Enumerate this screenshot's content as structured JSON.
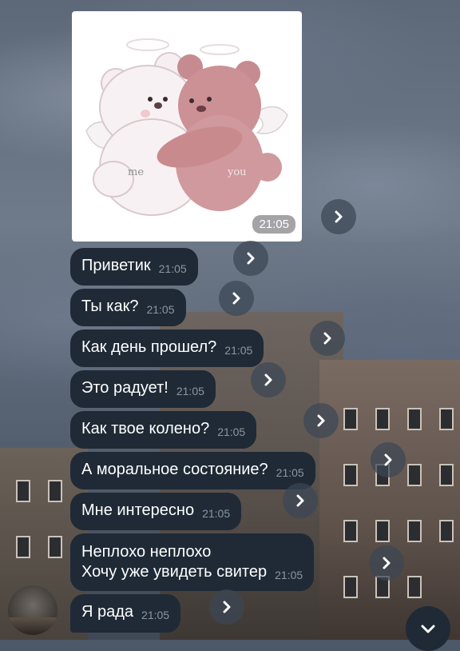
{
  "chat": {
    "photo": {
      "caption_left": "me",
      "caption_right": "you",
      "time": "21:05"
    },
    "messages": [
      {
        "text": "Приветик",
        "time": "21:05"
      },
      {
        "text": "Ты как?",
        "time": "21:05"
      },
      {
        "text": "Как день прошел?",
        "time": "21:05"
      },
      {
        "text": "Это радует!",
        "time": "21:05"
      },
      {
        "text": "Как твое колено?",
        "time": "21:05"
      },
      {
        "text": "А моральное состояние?",
        "time": "21:05"
      },
      {
        "text": "Мне интересно",
        "time": "21:05"
      },
      {
        "line1": "Неплохо неплохо",
        "line2": "Хочу уже увидеть свитер",
        "time": "21:05"
      },
      {
        "text": "Я рада",
        "time": "21:05"
      }
    ]
  },
  "icons": {
    "share": "forward-arrow-icon",
    "scroll": "chevron-down-icon",
    "avatar": "sender-avatar"
  },
  "colors": {
    "bubble": "#1f2a36",
    "bubble_text": "#ffffff",
    "time_text": "#8a96a3",
    "bear_pink": "#c98a8e",
    "bear_white": "#f3e8ea"
  }
}
